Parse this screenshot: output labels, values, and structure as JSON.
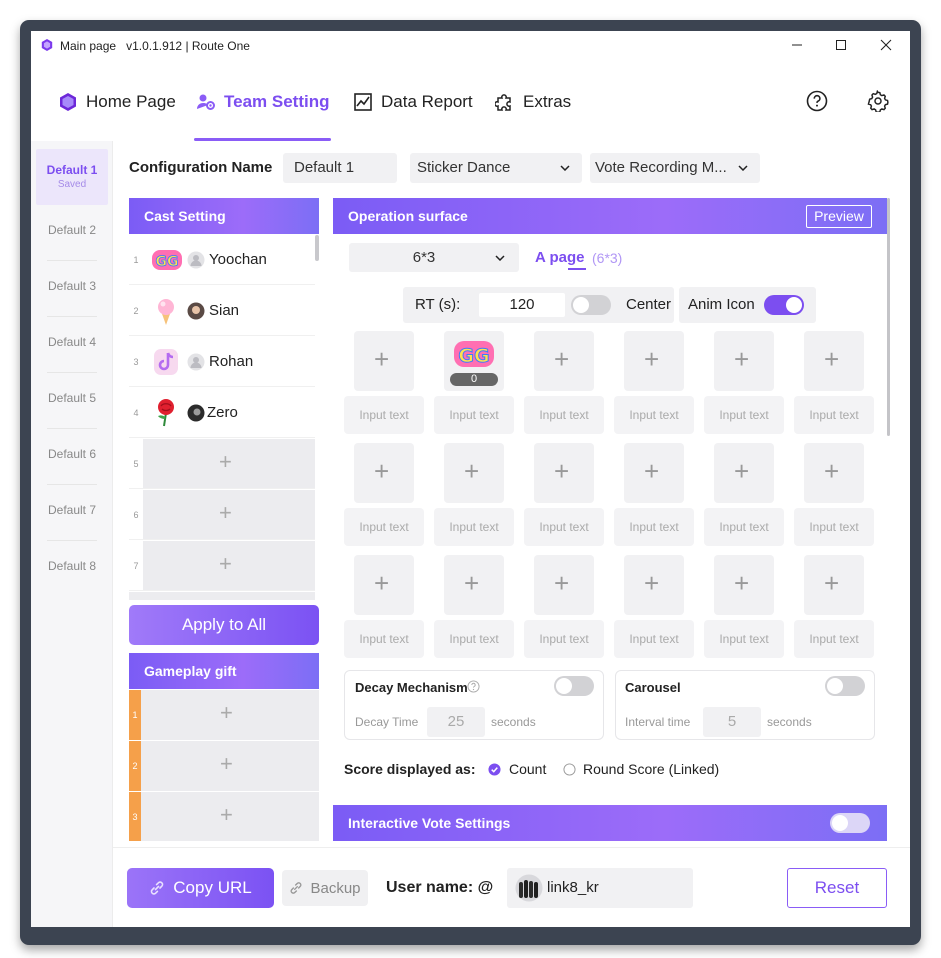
{
  "window": {
    "title": "Main page",
    "version_route": "v1.0.1.912 | Route One"
  },
  "nav": {
    "home": "Home Page",
    "team": "Team Setting",
    "report": "Data Report",
    "extras": "Extras"
  },
  "left_tabs": [
    {
      "label": "Default 1",
      "status": "Saved",
      "active": true
    },
    {
      "label": "Default 2"
    },
    {
      "label": "Default 3"
    },
    {
      "label": "Default 4"
    },
    {
      "label": "Default 5"
    },
    {
      "label": "Default 6"
    },
    {
      "label": "Default 7"
    },
    {
      "label": "Default 8"
    }
  ],
  "config": {
    "label": "Configuration Name",
    "name_value": "Default 1",
    "game_select": "Sticker Dance",
    "mode_select": "Vote Recording M..."
  },
  "cast": {
    "header": "Cast Setting",
    "rows": [
      {
        "num": "1",
        "name": "Yoochan"
      },
      {
        "num": "2",
        "name": "Sian"
      },
      {
        "num": "3",
        "name": "Rohan"
      },
      {
        "num": "4",
        "name": "Zero"
      },
      {
        "num": "5"
      },
      {
        "num": "6"
      },
      {
        "num": "7"
      }
    ],
    "apply_all": "Apply to All"
  },
  "gift": {
    "header": "Gameplay gift",
    "rows": [
      "1",
      "2",
      "3"
    ]
  },
  "operation": {
    "header": "Operation surface",
    "preview": "Preview",
    "layout_select": "6*3",
    "page_label": "A page",
    "page_dims": "(6*3)",
    "rt_label": "RT (s):",
    "rt_value": "120",
    "position_select": "Center",
    "anim_icon_label": "Anim Icon",
    "anim_icon_on": true,
    "rt_toggle_on": false,
    "cell_placeholder": "Input text",
    "first_cell_count": "0",
    "decay": {
      "title": "Decay Mechanism",
      "time_label": "Decay Time",
      "time_value": "25",
      "unit": "seconds",
      "enabled": false
    },
    "carousel": {
      "title": "Carousel",
      "interval_label": "Interval time",
      "interval_value": "5",
      "unit": "seconds",
      "enabled": false
    },
    "score_label": "Score displayed as:",
    "score_options": [
      "Count",
      "Round Score (Linked)"
    ],
    "score_selected": "Count"
  },
  "interactive_vote": {
    "header": "Interactive Vote Settings",
    "enabled": false
  },
  "bottom": {
    "copy_url": "Copy URL",
    "backup": "Backup",
    "user_label": "User name: @",
    "user_value": "link8_kr",
    "reset": "Reset"
  },
  "colors": {
    "accent": "#7c4ef0",
    "header_gradient_start": "#7b5cf5",
    "gift_number": "#f5a04a"
  }
}
